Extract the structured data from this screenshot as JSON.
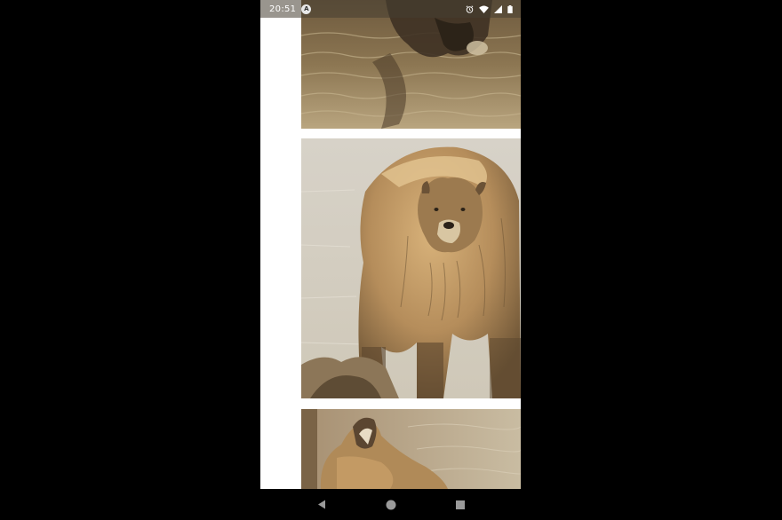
{
  "status_bar": {
    "time": "20:51",
    "app_badge": "A",
    "icons": [
      "alarm-icon",
      "wifi-icon",
      "cellular-signal-icon",
      "battery-icon"
    ]
  },
  "gallery": {
    "images": [
      {
        "subject": "bear-in-water-cropped"
      },
      {
        "subject": "grizzly-bear-standing"
      },
      {
        "subject": "bear-roaring"
      }
    ]
  },
  "nav_bar": {
    "buttons": [
      "back-icon",
      "home-icon",
      "recents-icon"
    ]
  },
  "colors": {
    "sepia_light": "#d8d0bd",
    "sepia_mid": "#a8875a",
    "sepia_dark": "#5a4a33"
  }
}
